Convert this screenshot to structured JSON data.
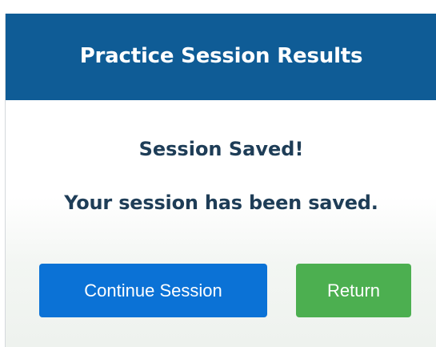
{
  "dialog": {
    "title": "Practice Session Results",
    "heading": "Session Saved!",
    "message": "Your session has been saved.",
    "buttons": {
      "continue_label": "Continue Session",
      "return_label": "Return"
    }
  },
  "colors": {
    "header_bg": "#0f5c96",
    "text": "#1e3d57",
    "primary_button": "#0b72d6",
    "success_button": "#4caf50"
  }
}
